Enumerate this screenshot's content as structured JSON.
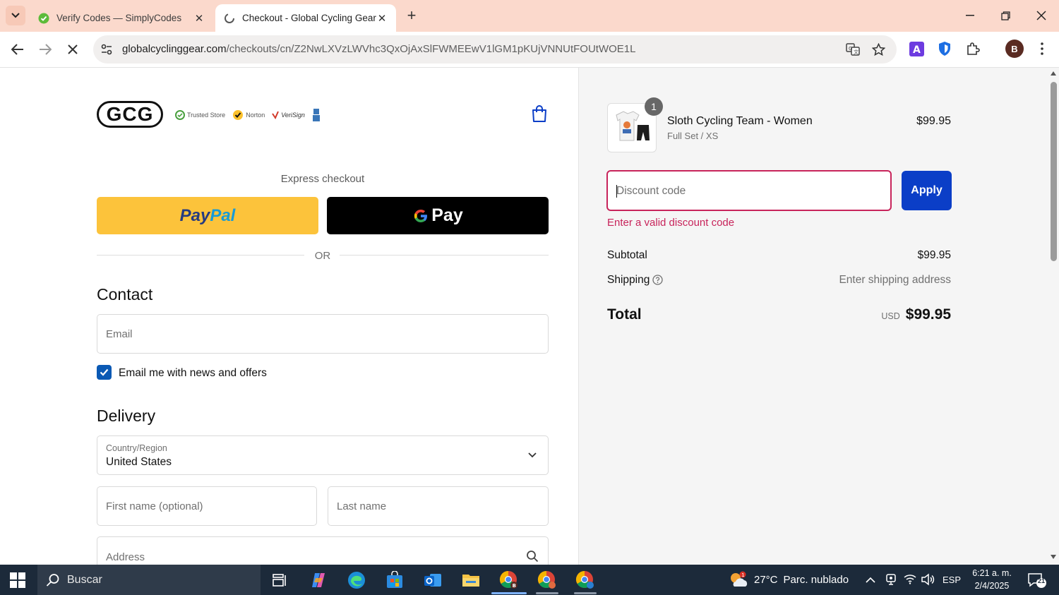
{
  "browser": {
    "tabs": [
      {
        "title": "Verify Codes — SimplyCodes",
        "active": false
      },
      {
        "title": "Checkout - Global Cycling Gear",
        "active": true
      }
    ],
    "url_host": "globalcyclinggear.com",
    "url_path": "/checkouts/cn/Z2NwLXVzLWVhc3QxOjAxSlFWMEEwV1lGM1pKUjVNNUtFOUtWOE1L",
    "profile_initial": "B"
  },
  "header": {
    "logo_text": "GCG",
    "badges": [
      "Trusted Store",
      "Norton",
      "VeriSign"
    ]
  },
  "express": {
    "label": "Express checkout",
    "paypal_part1": "Pay",
    "paypal_part2": "Pal",
    "gpay_label": "Pay",
    "or_label": "OR"
  },
  "contact": {
    "heading": "Contact",
    "email_placeholder": "Email",
    "newsletter_label": "Email me with news and offers",
    "newsletter_checked": true
  },
  "delivery": {
    "heading": "Delivery",
    "country_label": "Country/Region",
    "country_value": "United States",
    "first_name_placeholder": "First name (optional)",
    "last_name_placeholder": "Last name",
    "address_placeholder": "Address"
  },
  "summary": {
    "product": {
      "name": "Sloth Cycling Team - Women",
      "variant": "Full Set / XS",
      "price": "$99.95",
      "quantity": "1"
    },
    "discount_placeholder": "Discount code",
    "apply_label": "Apply",
    "discount_error": "Enter a valid discount code",
    "subtotal_label": "Subtotal",
    "subtotal_value": "$99.95",
    "shipping_label": "Shipping",
    "shipping_value": "Enter shipping address",
    "total_label": "Total",
    "total_currency": "USD",
    "total_value": "$99.95"
  },
  "taskbar": {
    "search_label": "Buscar",
    "weather_temp": "27°C",
    "weather_desc": "Parc. nublado",
    "weather_alert": "1",
    "language": "ESP",
    "time": "6:21 a. m.",
    "date": "2/4/2025",
    "notifications": "21"
  },
  "colors": {
    "accent": "#0b3ec7",
    "error": "#c8245b",
    "checkbox": "#0a59b4",
    "paypal": "#fcc33b",
    "tabbar": "#fbd9cc"
  }
}
